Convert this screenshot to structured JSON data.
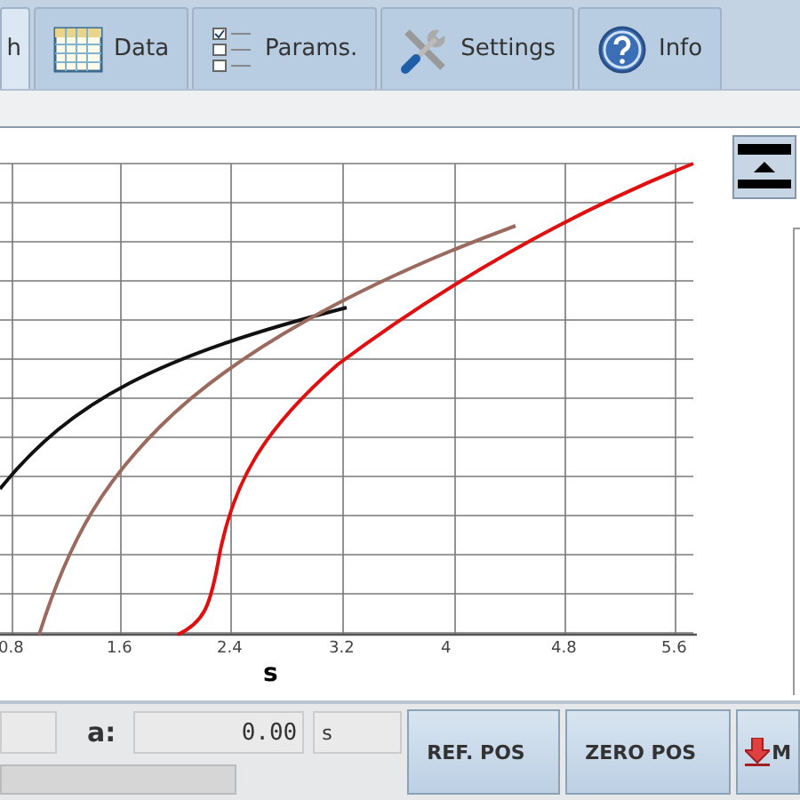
{
  "tabs": [
    {
      "label": "h",
      "kind": "plain",
      "selected": true
    },
    {
      "label": "Data",
      "kind": "table",
      "selected": false
    },
    {
      "label": "Params.",
      "kind": "checklist",
      "selected": false
    },
    {
      "label": "Settings",
      "kind": "tools",
      "selected": false
    },
    {
      "label": "Info",
      "kind": "help",
      "selected": false
    }
  ],
  "graph": {
    "xtick_labels": [
      "0.8",
      "1.6",
      "2.4",
      "3.2",
      "4",
      "4.8",
      "5.6"
    ],
    "xlabel": "s"
  },
  "bottom_bar": {
    "a_label": "a:",
    "a_value": "0.00",
    "a_unit": "s",
    "buttons": [
      {
        "label": "REF. POS",
        "kind": "plain"
      },
      {
        "label": "ZERO POS",
        "kind": "plain"
      },
      {
        "label": "M",
        "kind": "download"
      }
    ]
  }
}
